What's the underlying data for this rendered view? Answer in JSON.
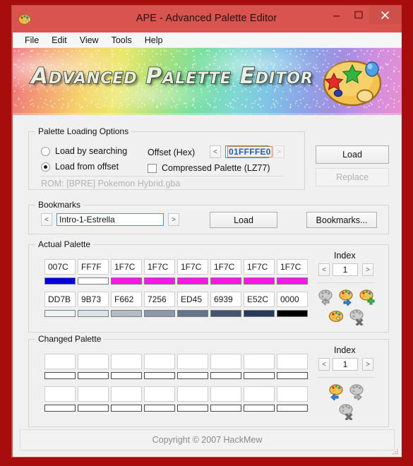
{
  "window": {
    "title": "APE - Advanced Palette Editor",
    "icon": "palette-icon",
    "controls": {
      "minimize": "minimize-icon",
      "maximize": "maximize-icon",
      "close": "close-icon"
    },
    "frame_color": "#a80d0d",
    "titlebar_color": "#d9544f"
  },
  "menu": {
    "items": [
      {
        "label": "File"
      },
      {
        "label": "Edit"
      },
      {
        "label": "View"
      },
      {
        "label": "Tools"
      },
      {
        "label": "Help"
      }
    ]
  },
  "banner": {
    "title": "Advanced Palette Editor",
    "icon": "artist-palette-icon"
  },
  "palette_loading": {
    "title": "Palette Loading Options",
    "radios": [
      {
        "label": "Load by searching",
        "checked": false
      },
      {
        "label": "Load from offset",
        "checked": true
      }
    ],
    "offset_label": "Offset (Hex)",
    "offset_prev": "<",
    "offset_next": ">",
    "offset_value": "01FFFFE0",
    "compressed_label": "Compressed Palette (LZ77)",
    "compressed_checked": false,
    "rom_label": "ROM: [BPRE] Pokemon Hybrid.gba",
    "load_button": "Load",
    "replace_button": "Replace",
    "replace_enabled": false
  },
  "bookmarks": {
    "title": "Bookmarks",
    "prev": "<",
    "next": ">",
    "value": "Intro-1-Estrella",
    "load_button": "Load",
    "manage_button": "Bookmarks..."
  },
  "actual_palette": {
    "title": "Actual Palette",
    "index_label": "Index",
    "index_prev": "<",
    "index_next": ">",
    "index_value": "1",
    "rows": [
      [
        {
          "hex": "007C",
          "color": "#0000dd"
        },
        {
          "hex": "FF7F",
          "color": "#ffffff"
        },
        {
          "hex": "1F7C",
          "color": "#f917e8"
        },
        {
          "hex": "1F7C",
          "color": "#f917e8"
        },
        {
          "hex": "1F7C",
          "color": "#f917e8"
        },
        {
          "hex": "1F7C",
          "color": "#f917e8"
        },
        {
          "hex": "1F7C",
          "color": "#f917e8"
        },
        {
          "hex": "1F7C",
          "color": "#f917e8"
        }
      ],
      [
        {
          "hex": "DD7B",
          "color": "#edf6f5"
        },
        {
          "hex": "9B73",
          "color": "#dbe5e5"
        },
        {
          "hex": "F662",
          "color": "#b1bcc6"
        },
        {
          "hex": "7256",
          "color": "#8b97ab"
        },
        {
          "hex": "ED45",
          "color": "#64748d"
        },
        {
          "hex": "6939",
          "color": "#46546f"
        },
        {
          "hex": "E52C",
          "color": "#283a5c"
        },
        {
          "hex": "0000",
          "color": "#000000"
        }
      ]
    ],
    "icons": [
      {
        "name": "restore-palette-icon",
        "enabled": false
      },
      {
        "name": "copy-palette-icon",
        "enabled": true
      },
      {
        "name": "add-palette-icon",
        "enabled": true
      },
      {
        "name": "edit-palette-icon",
        "enabled": true
      },
      {
        "name": "delete-palette-icon",
        "enabled": false
      }
    ]
  },
  "changed_palette": {
    "title": "Changed Palette",
    "index_label": "Index",
    "index_prev": "<",
    "index_next": ">",
    "index_value": "1",
    "rows": [
      [
        "",
        "",
        "",
        "",
        "",
        "",
        "",
        ""
      ],
      [
        "",
        "",
        "",
        "",
        "",
        "",
        "",
        ""
      ]
    ],
    "icons": [
      {
        "name": "apply-palette-icon",
        "enabled": true
      },
      {
        "name": "export-palette-icon",
        "enabled": false
      },
      {
        "name": "clear-palette-icon",
        "enabled": false
      }
    ]
  },
  "footer": {
    "text": "Copyright © 2007 HackMew"
  }
}
